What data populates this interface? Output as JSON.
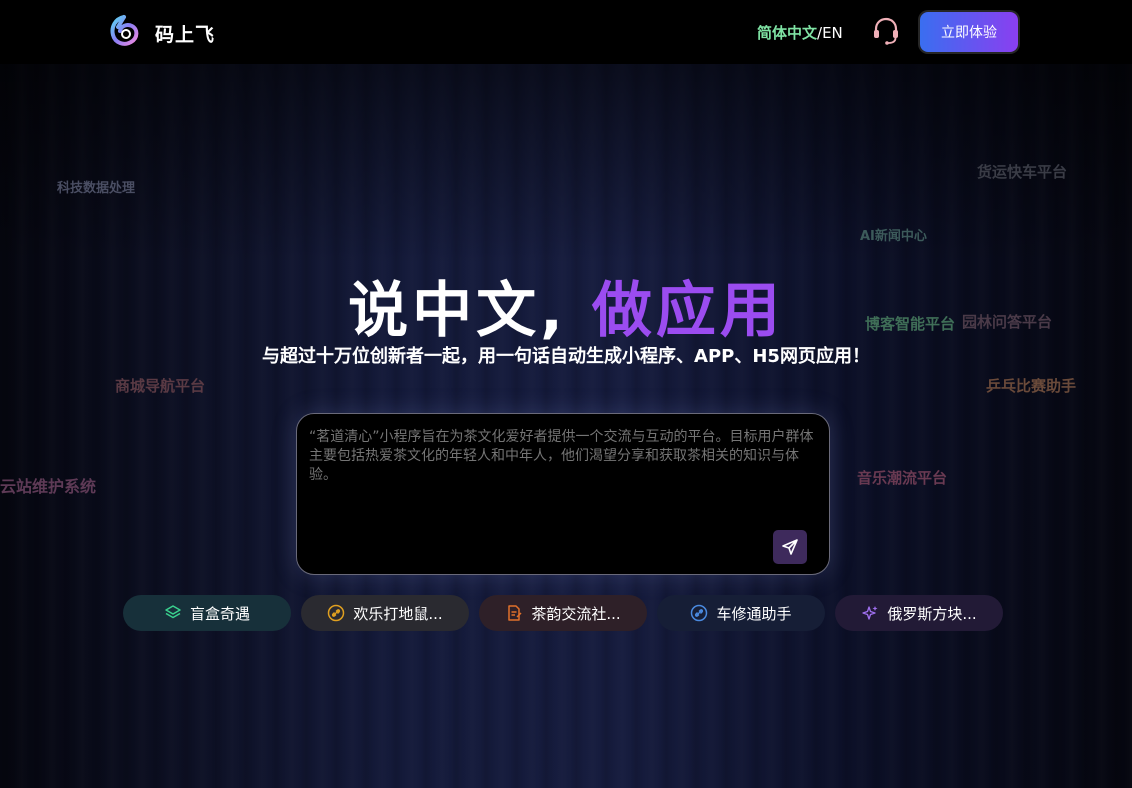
{
  "header": {
    "brand": "码上飞",
    "lang_zh": "简体中文",
    "lang_sep": "/",
    "lang_en": "EN",
    "try_button": "立即体验"
  },
  "floating_tags": [
    {
      "label": "科技数据处理",
      "color": "#4a4e63"
    },
    {
      "label": "货运快车平台",
      "color": "#3a3c46"
    },
    {
      "label": "AI新闻中心",
      "color": "#3c5a5a"
    },
    {
      "label": "博客智能平台",
      "color": "#3f6e57"
    },
    {
      "label": "园林问答平台",
      "color": "#4a3a48"
    },
    {
      "label": "商城导航平台",
      "color": "#5a3a44"
    },
    {
      "label": "乒乓比赛助手",
      "color": "#6a4a3a"
    },
    {
      "label": "云站维护系统",
      "color": "#5e3a56"
    },
    {
      "label": "音乐潮流平台",
      "color": "#6a3a52"
    }
  ],
  "hero": {
    "title_main": "说中文,",
    "title_accent": "做应用",
    "subtitle": "与超过十万位创新者一起，用一句话自动生成小程序、APP、H5网页应用！",
    "accent_color": "#9b4cf0"
  },
  "prompt": {
    "placeholder": "“茗道清心”小程序旨在为茶文化爱好者提供一个交流与互动的平台。目标用户群体主要包括热爱茶文化的年轻人和中年人，他们渴望分享和获取茶相关的知识与体验。"
  },
  "examples": [
    {
      "label": "盲盒奇遇",
      "icon": "layers-icon",
      "bg": "#17303a",
      "icon_color": "#3ad18e"
    },
    {
      "label": "欢乐打地鼠...",
      "icon": "link-icon",
      "bg": "#2a2a30",
      "icon_color": "#e0a020"
    },
    {
      "label": "茶韵交流社...",
      "icon": "document-icon",
      "bg": "#2e2028",
      "icon_color": "#e0702a"
    },
    {
      "label": "车修通助手",
      "icon": "link-icon",
      "bg": "#161e36",
      "icon_color": "#4a8ae0"
    },
    {
      "label": "俄罗斯方块...",
      "icon": "sparkles-icon",
      "bg": "#221a36",
      "icon_color": "#a070f0"
    }
  ]
}
